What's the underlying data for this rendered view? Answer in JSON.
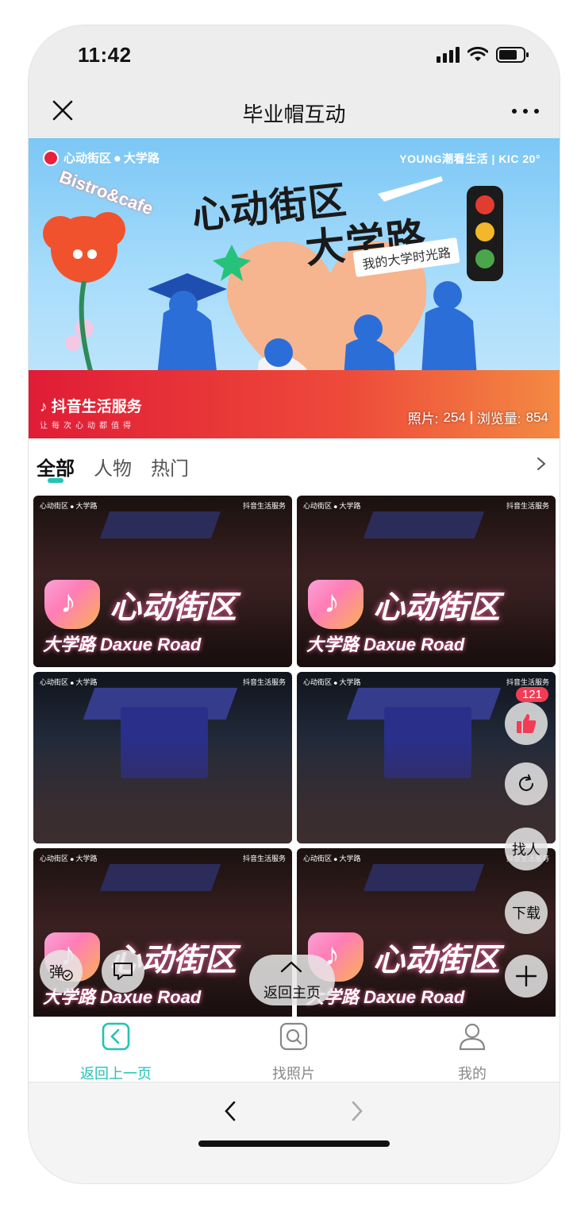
{
  "status_bar": {
    "time": "11:42"
  },
  "title_bar": {
    "title": "毕业帽互动"
  },
  "banner": {
    "brand_left": "心动街区 ⦁ 大学路",
    "brand_right": "YOUNG潮看生活 | KIC 20°",
    "headline_line1": "心动街区",
    "headline_line2": "大学路",
    "tagline": "我的大学时光路",
    "side_text": "Bistro&cafe",
    "bottom_brand": "抖音生活服务",
    "bottom_sub": "让每次心动都值得",
    "photos_label": "照片:",
    "photos_count": "254",
    "views_label": "浏览量:",
    "views_count": "854"
  },
  "tabs": [
    {
      "label": "全部",
      "active": true
    },
    {
      "label": "人物",
      "active": false
    },
    {
      "label": "热门",
      "active": false
    }
  ],
  "photos": {
    "watermark_left": "心动街区 ⦁ 大学路",
    "watermark_right": "抖音生活服务",
    "sign_main": "心动街区",
    "sign_sub": "大学路 Daxue Road"
  },
  "floating": {
    "like_count": "121",
    "find_person": "找人",
    "download": "下载",
    "danmaku": "弹",
    "home": "返回主页"
  },
  "bottom_nav": [
    {
      "label": "返回上一页",
      "icon": "back-square-icon",
      "active": true
    },
    {
      "label": "找照片",
      "icon": "search-photo-icon",
      "active": false
    },
    {
      "label": "我的",
      "icon": "user-icon",
      "active": false
    }
  ],
  "colors": {
    "accent": "#22c3b5",
    "like_badge": "#f23c55",
    "banner_red": "#e01c36"
  }
}
